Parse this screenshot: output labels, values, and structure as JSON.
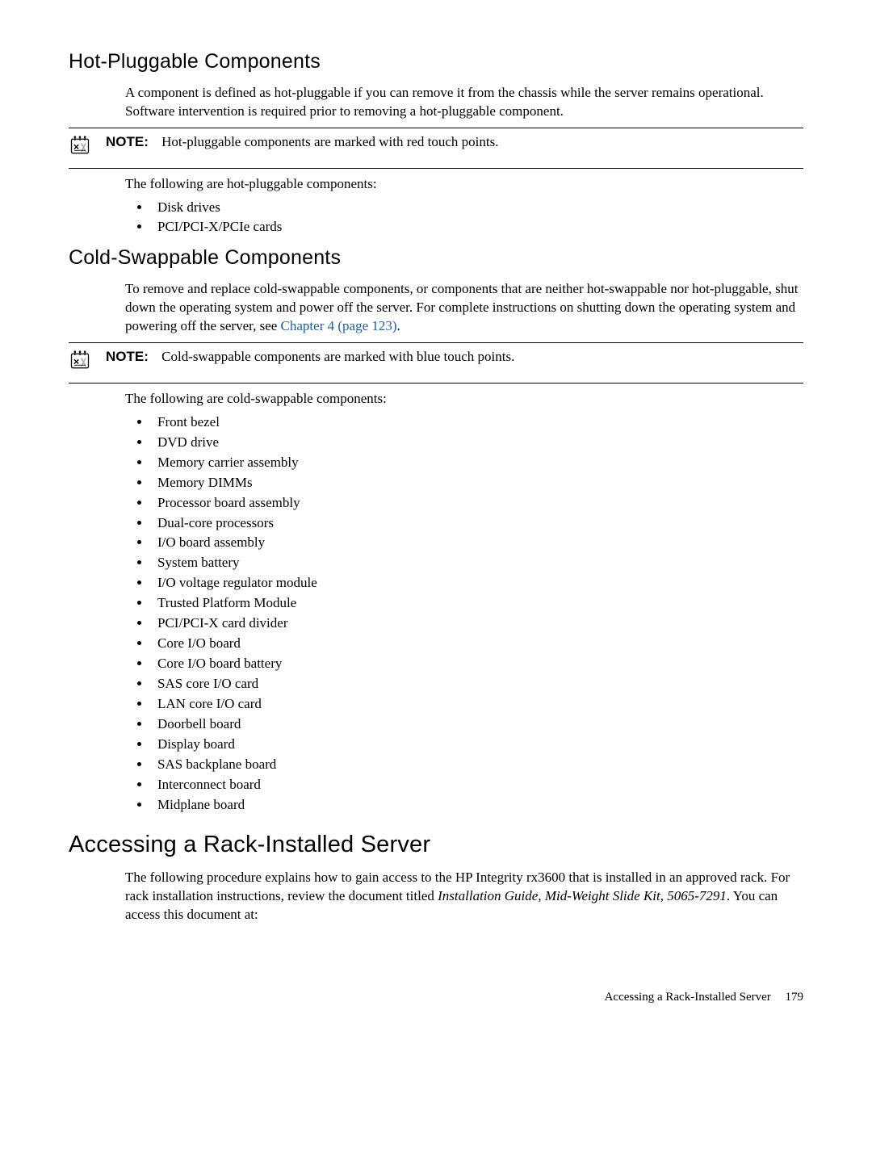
{
  "sections": {
    "hotPluggable": {
      "title": "Hot-Pluggable Components",
      "intro": "A component is defined as hot-pluggable if you can remove it from the chassis while the server remains operational. Software intervention is required prior to removing a hot-pluggable component.",
      "noteLabel": "NOTE:",
      "noteText": "Hot-pluggable components are marked with red touch points.",
      "listIntro": "The following are hot-pluggable components:",
      "items": [
        "Disk drives",
        "PCI/PCI-X/PCIe cards"
      ]
    },
    "coldSwappable": {
      "title": "Cold-Swappable Components",
      "introPart1": "To remove and replace cold-swappable components, or components that are neither hot-swappable nor hot-pluggable, shut down the operating system and power off the server. For complete instructions on shutting down the operating system and powering off the server, see ",
      "introLink": "Chapter 4 (page 123)",
      "introPart2": ".",
      "noteLabel": "NOTE:",
      "noteText": "Cold-swappable components are marked with blue touch points.",
      "listIntro": "The following are cold-swappable components:",
      "items": [
        "Front bezel",
        "DVD drive",
        "Memory carrier assembly",
        "Memory DIMMs",
        "Processor board assembly",
        "Dual-core processors",
        "I/O board assembly",
        "System battery",
        "I/O voltage regulator module",
        "Trusted Platform Module",
        "PCI/PCI-X card divider",
        "Core I/O board",
        "Core I/O board battery",
        "SAS core I/O card",
        "LAN core I/O card",
        "Doorbell board",
        "Display board",
        "SAS backplane board",
        "Interconnect board",
        "Midplane board"
      ]
    },
    "accessing": {
      "title": "Accessing a Rack-Installed Server",
      "introPart1": "The following procedure explains how to gain access to the HP Integrity rx3600 that is installed in an approved rack. For rack installation instructions, review the document titled ",
      "introItalic": "Installation Guide, Mid-Weight Slide Kit, 5065-7291",
      "introPart2": ". You can access this document at:"
    }
  },
  "footer": {
    "text": "Accessing a Rack-Installed Server",
    "page": "179"
  }
}
